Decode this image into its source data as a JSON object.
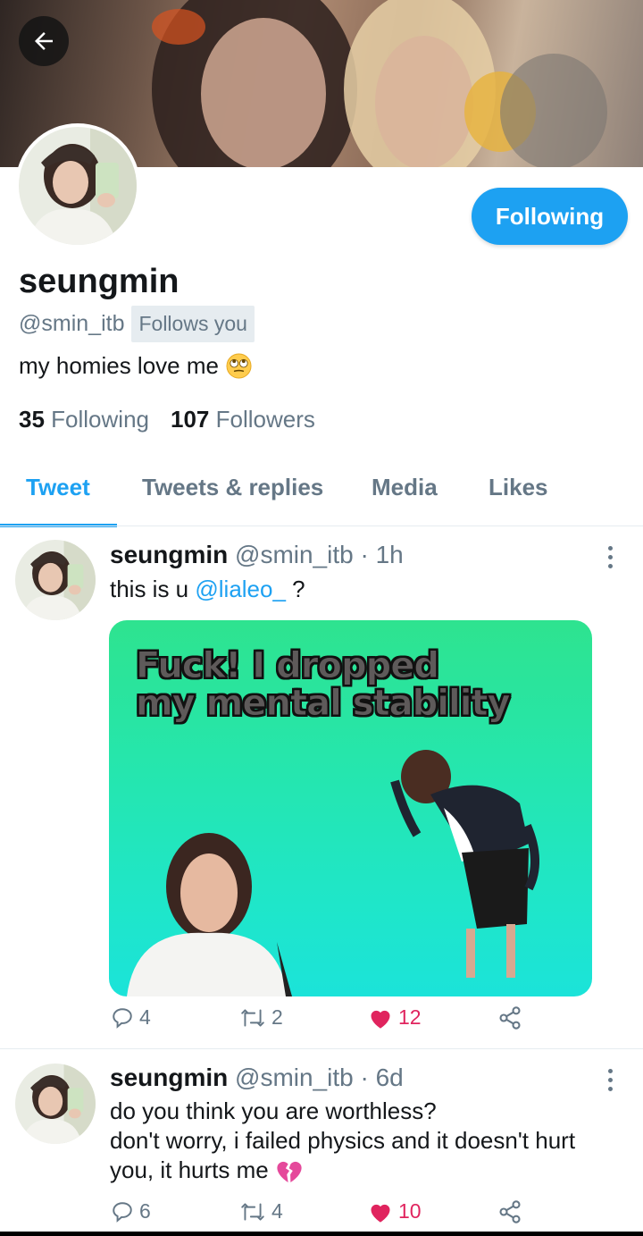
{
  "profile": {
    "display_name": "seungmin",
    "handle": "@smin_itb",
    "follows_you": "Follows you",
    "bio": "my homies love me",
    "following_count": "35",
    "following_label": "Following",
    "followers_count": "107",
    "followers_label": "Followers",
    "follow_button": "Following"
  },
  "tabs": [
    {
      "label": "Tweet",
      "active": true
    },
    {
      "label": "Tweets & replies",
      "active": false
    },
    {
      "label": "Media",
      "active": false
    },
    {
      "label": "Likes",
      "active": false
    }
  ],
  "tweets": [
    {
      "name": "seungmin",
      "handle": "@smin_itb",
      "separator": "·",
      "time": "1h",
      "text_before": "this is u ",
      "mention": "@lialeo_",
      "text_after": " ?",
      "media_text": [
        "Fuck! I dropped",
        "my mental stability"
      ],
      "replies": "4",
      "retweets": "2",
      "likes": "12"
    },
    {
      "name": "seungmin",
      "handle": "@smin_itb",
      "separator": "·",
      "time": "6d",
      "lines": [
        "do you think you are worthless?",
        "don't worry, i failed physics and it doesn't hurt",
        "you, it hurts me"
      ],
      "replies": "6",
      "retweets": "4",
      "likes": "10"
    }
  ],
  "colors": {
    "accent": "#1da1f2",
    "like": "#e0245e",
    "muted": "#657786"
  },
  "icons": {
    "back": "arrow-left-icon",
    "reply": "reply-icon",
    "retweet": "retweet-icon",
    "like": "heart-icon",
    "share": "share-icon",
    "more": "more-vertical-icon"
  }
}
